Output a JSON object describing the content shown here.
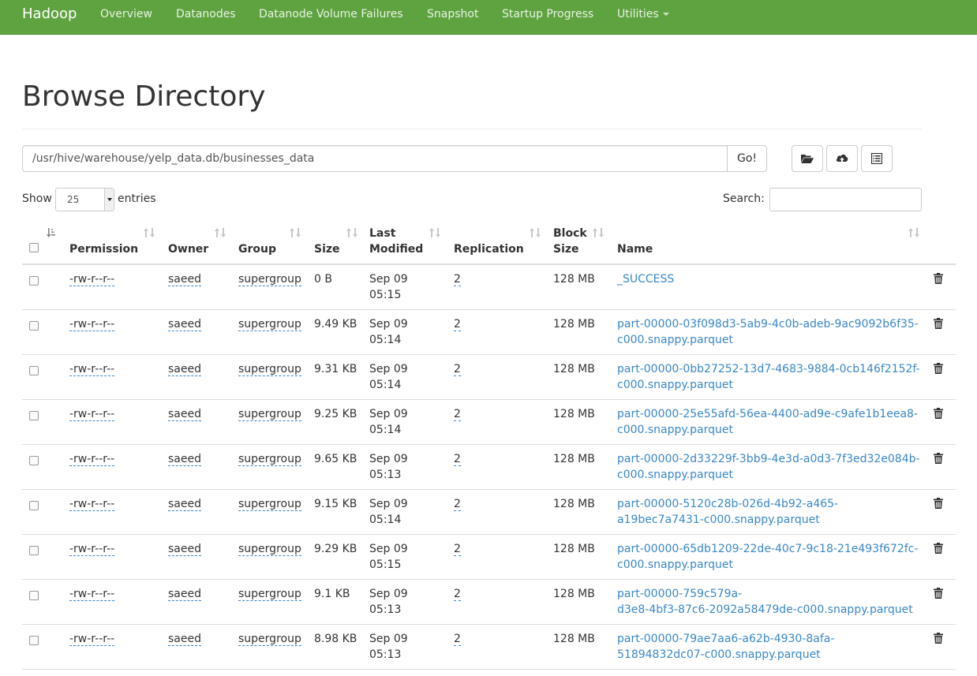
{
  "navbar": {
    "brand": "Hadoop",
    "links": [
      "Overview",
      "Datanodes",
      "Datanode Volume Failures",
      "Snapshot",
      "Startup Progress",
      "Utilities"
    ]
  },
  "page": {
    "title": "Browse Directory"
  },
  "path_bar": {
    "path_value": "/usr/hive/warehouse/yelp_data.db/businesses_data",
    "go_label": "Go!",
    "tool_icons": [
      "folder-open-icon",
      "cloud-upload-icon",
      "list-alt-icon"
    ]
  },
  "controls": {
    "show_label": "Show",
    "entries_value": "25",
    "entries_label": "entries",
    "search_label": "Search:",
    "search_value": ""
  },
  "table": {
    "headers": {
      "permission": "Permission",
      "owner": "Owner",
      "group": "Group",
      "size": "Size",
      "last_modified_1": "Last",
      "last_modified_2": "Modified",
      "replication": "Replication",
      "block_size_1": "Block",
      "block_size_2": "Size",
      "name": "Name"
    },
    "rows": [
      {
        "permission": "-rw-r--r--",
        "owner": "saeed",
        "group": "supergroup",
        "size": "0 B",
        "date": "Sep 09",
        "time": "05:15",
        "replication": "2",
        "block_size": "128 MB",
        "name1": "_SUCCESS",
        "name2": ""
      },
      {
        "permission": "-rw-r--r--",
        "owner": "saeed",
        "group": "supergroup",
        "size": "9.49 KB",
        "date": "Sep 09",
        "time": "05:14",
        "replication": "2",
        "block_size": "128 MB",
        "name1": "part-00000-03f098d3-5ab9-4c0b-adeb-9ac9092b6f35-",
        "name2": "c000.snappy.parquet"
      },
      {
        "permission": "-rw-r--r--",
        "owner": "saeed",
        "group": "supergroup",
        "size": "9.31 KB",
        "date": "Sep 09",
        "time": "05:14",
        "replication": "2",
        "block_size": "128 MB",
        "name1": "part-00000-0bb27252-13d7-4683-9884-0cb146f2152f-",
        "name2": "c000.snappy.parquet"
      },
      {
        "permission": "-rw-r--r--",
        "owner": "saeed",
        "group": "supergroup",
        "size": "9.25 KB",
        "date": "Sep 09",
        "time": "05:14",
        "replication": "2",
        "block_size": "128 MB",
        "name1": "part-00000-25e55afd-56ea-4400-ad9e-c9afe1b1eea8-",
        "name2": "c000.snappy.parquet"
      },
      {
        "permission": "-rw-r--r--",
        "owner": "saeed",
        "group": "supergroup",
        "size": "9.65 KB",
        "date": "Sep 09",
        "time": "05:13",
        "replication": "2",
        "block_size": "128 MB",
        "name1": "part-00000-2d33229f-3bb9-4e3d-a0d3-7f3ed32e084b-",
        "name2": "c000.snappy.parquet"
      },
      {
        "permission": "-rw-r--r--",
        "owner": "saeed",
        "group": "supergroup",
        "size": "9.15 KB",
        "date": "Sep 09",
        "time": "05:14",
        "replication": "2",
        "block_size": "128 MB",
        "name1": "part-00000-5120c28b-026d-4b92-a465-",
        "name2": "a19bec7a7431-c000.snappy.parquet"
      },
      {
        "permission": "-rw-r--r--",
        "owner": "saeed",
        "group": "supergroup",
        "size": "9.29 KB",
        "date": "Sep 09",
        "time": "05:15",
        "replication": "2",
        "block_size": "128 MB",
        "name1": "part-00000-65db1209-22de-40c7-9c18-21e493f672fc-",
        "name2": "c000.snappy.parquet"
      },
      {
        "permission": "-rw-r--r--",
        "owner": "saeed",
        "group": "supergroup",
        "size": "9.1 KB",
        "date": "Sep 09",
        "time": "05:13",
        "replication": "2",
        "block_size": "128 MB",
        "name1": "part-00000-759c579a-",
        "name2": "d3e8-4bf3-87c6-2092a58479de-c000.snappy.parquet"
      },
      {
        "permission": "-rw-r--r--",
        "owner": "saeed",
        "group": "supergroup",
        "size": "8.98 KB",
        "date": "Sep 09",
        "time": "05:13",
        "replication": "2",
        "block_size": "128 MB",
        "name1": "part-00000-79ae7aa6-a62b-4930-8afa-",
        "name2": "51894832dc07-c000.snappy.parquet"
      }
    ]
  },
  "colors": {
    "navbar_bg": "#5fa341",
    "link": "#3a87c8",
    "text": "#333333",
    "border": "#dddddd"
  }
}
